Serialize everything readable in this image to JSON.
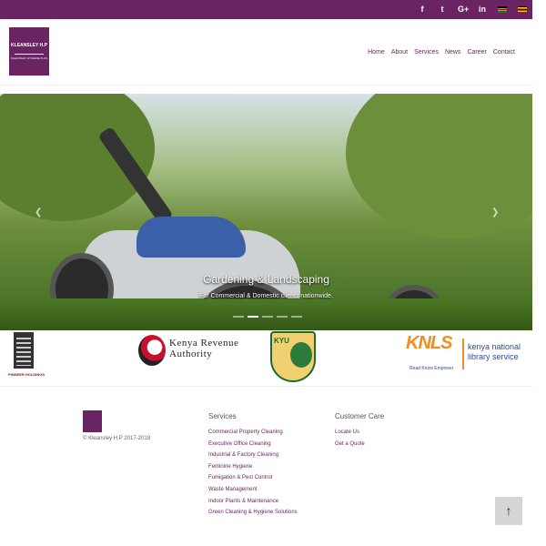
{
  "topbar": {
    "social": [
      {
        "name": "facebook-icon",
        "glyph": "f"
      },
      {
        "name": "twitter-icon",
        "glyph": "t"
      },
      {
        "name": "google-plus-icon",
        "glyph": "G+"
      },
      {
        "name": "linkedin-icon",
        "glyph": "in"
      }
    ],
    "flags": [
      "kenya-flag",
      "uganda-flag"
    ]
  },
  "header": {
    "logo_title": "KLEANSLEY H.P",
    "logo_subtitle": "KLEANSLEY HYGIENE PLUS",
    "logo_tagline": "Cleaning and Hygiene Solutions",
    "nav": [
      "Home",
      "About",
      "Services",
      "News",
      "Career",
      "Contact"
    ]
  },
  "hero": {
    "caption": "Gardening & Landscaping",
    "subcaption": "For Commercial & Domestic clients nationwide.",
    "slides": 5,
    "active_slide": 2
  },
  "partners": {
    "pinnacle": "PINNEER HOLDINGS",
    "kra_line1": "Kenya Revenue",
    "kra_line2": "Authority",
    "kyu": "KYU",
    "knls_big": "KNLS",
    "knls_tag": "Read Know Empower",
    "knls_line1": "kenya national",
    "knls_line2": "library service"
  },
  "footer": {
    "copyright": "© Kleansley H.P 2017-2018",
    "services_heading": "Services",
    "services": [
      "Commercial Property Cleaning",
      "Executive Office Cleaning",
      "Industrial & Factory Cleaning",
      "Feminine Hygiene",
      "Fumigation & Pest Control",
      "Waste Management",
      "Indoor Plants & Maintenance",
      "Green Cleaning & Hygiene Solutions"
    ],
    "care_heading": "Customer Care",
    "care": [
      "Locate Us",
      "Get a Quote"
    ]
  },
  "colors": {
    "brand": "#6b2463",
    "knls_orange": "#f28c1e",
    "knls_blue": "#2a4fa0"
  }
}
